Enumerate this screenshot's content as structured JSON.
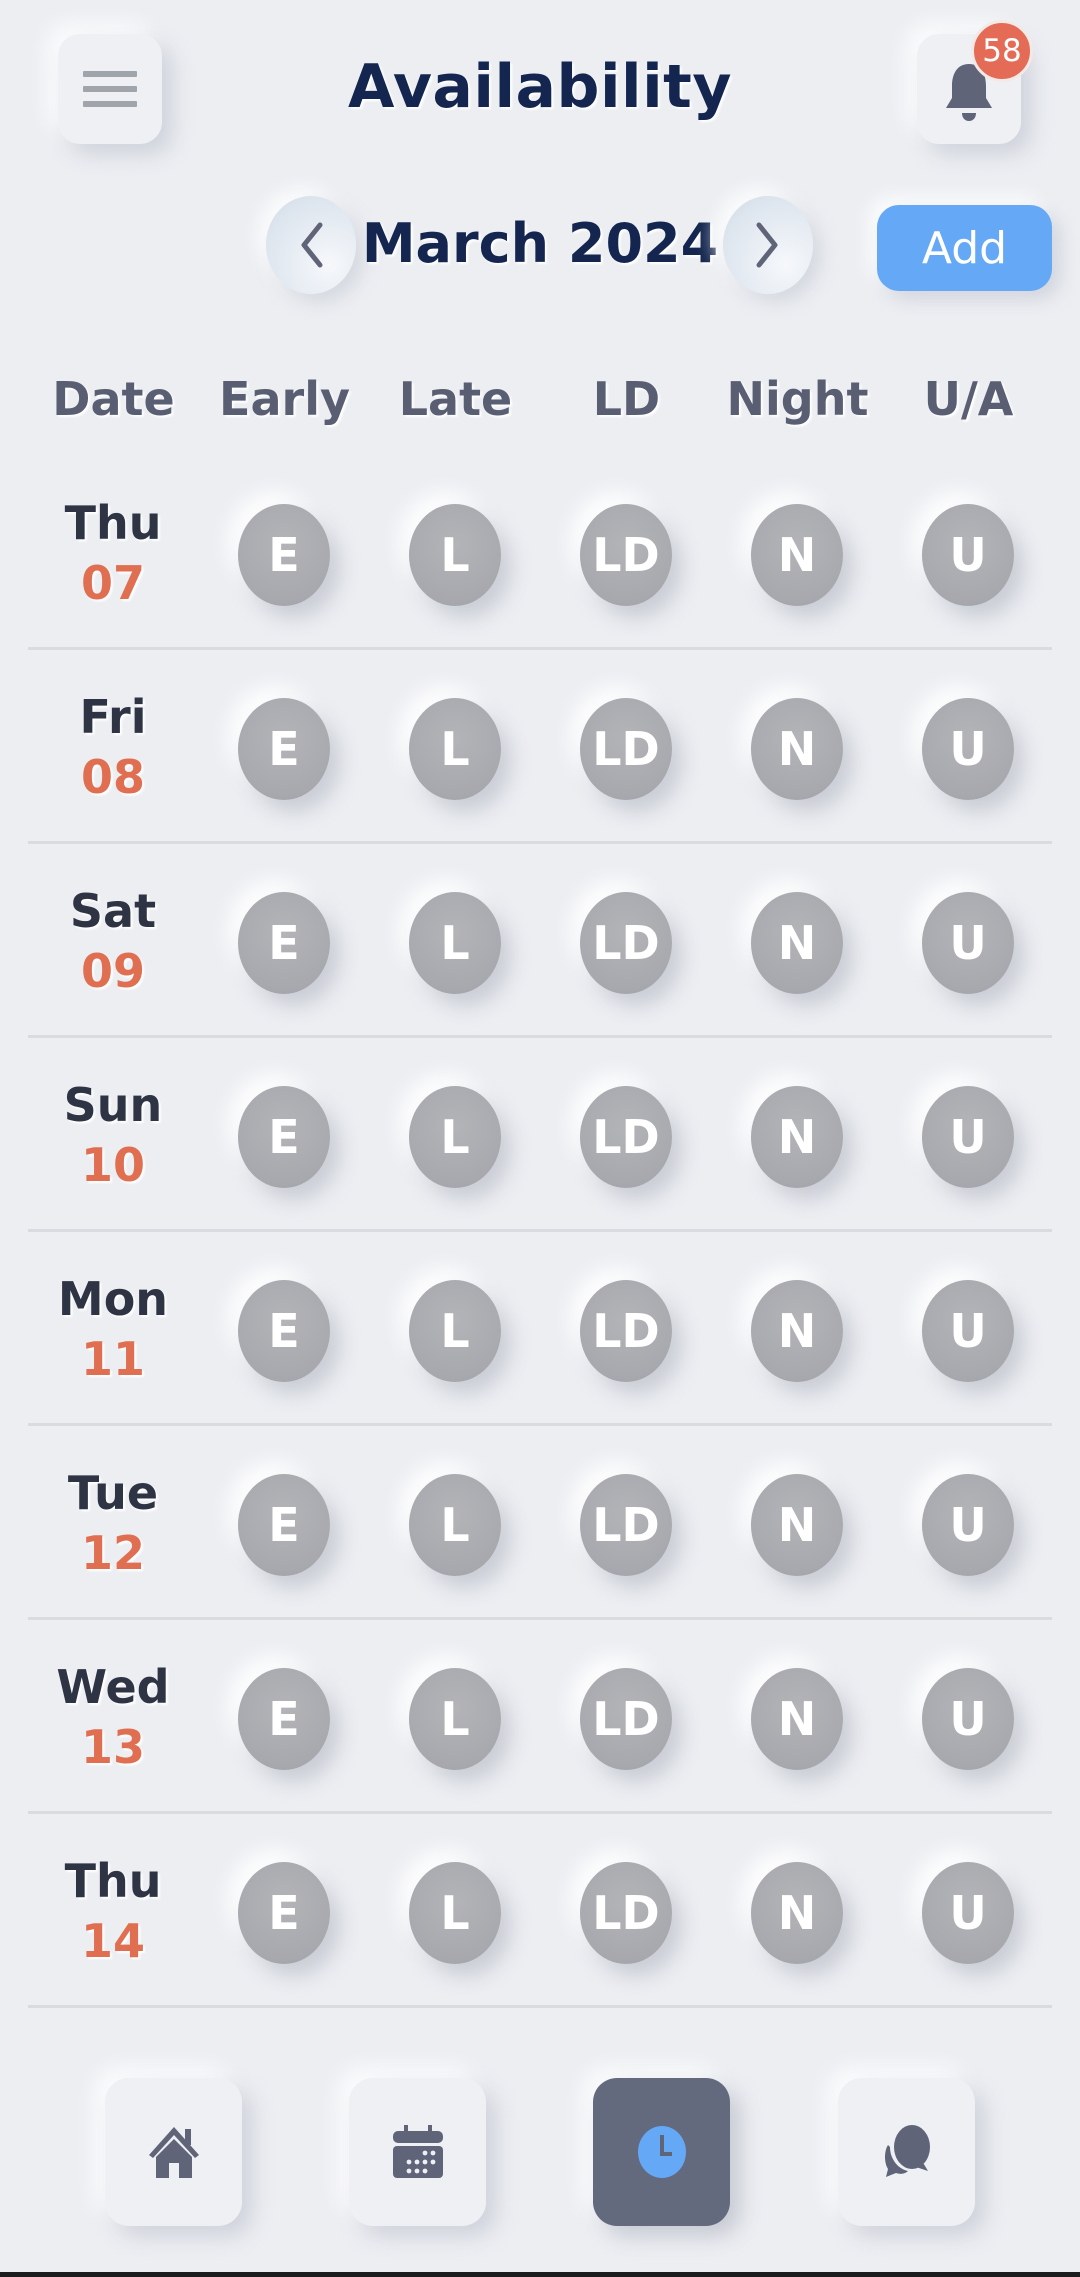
{
  "header": {
    "title": "Availability",
    "menu_icon": "hamburger-menu-icon",
    "notification_icon": "bell-icon",
    "notification_count": "58"
  },
  "month_nav": {
    "prev_icon": "chevron-left-icon",
    "month": "March 2024",
    "next_icon": "chevron-right-icon",
    "add_label": "Add"
  },
  "table": {
    "columns": [
      "Date",
      "Early",
      "Late",
      "LD",
      "Night",
      "U/A"
    ],
    "shift_codes": [
      "E",
      "L",
      "LD",
      "N",
      "U"
    ],
    "rows": [
      {
        "day": "Thu",
        "date": "07",
        "shifts": [
          "E",
          "L",
          "LD",
          "N",
          "U"
        ]
      },
      {
        "day": "Fri",
        "date": "08",
        "shifts": [
          "E",
          "L",
          "LD",
          "N",
          "U"
        ]
      },
      {
        "day": "Sat",
        "date": "09",
        "shifts": [
          "E",
          "L",
          "LD",
          "N",
          "U"
        ]
      },
      {
        "day": "Sun",
        "date": "10",
        "shifts": [
          "E",
          "L",
          "LD",
          "N",
          "U"
        ]
      },
      {
        "day": "Mon",
        "date": "11",
        "shifts": [
          "E",
          "L",
          "LD",
          "N",
          "U"
        ]
      },
      {
        "day": "Tue",
        "date": "12",
        "shifts": [
          "E",
          "L",
          "LD",
          "N",
          "U"
        ]
      },
      {
        "day": "Wed",
        "date": "13",
        "shifts": [
          "E",
          "L",
          "LD",
          "N",
          "U"
        ]
      },
      {
        "day": "Thu",
        "date": "14",
        "shifts": [
          "E",
          "L",
          "LD",
          "N",
          "U"
        ]
      }
    ]
  },
  "bottom_nav": {
    "items": [
      {
        "name": "home",
        "icon": "home-icon",
        "active": false
      },
      {
        "name": "calendar",
        "icon": "calendar-icon",
        "active": false
      },
      {
        "name": "availability",
        "icon": "clock-icon",
        "active": true
      },
      {
        "name": "messages",
        "icon": "chat-bubbles-icon",
        "active": false
      }
    ]
  },
  "colors": {
    "background": "#eceef2",
    "title": "#14264f",
    "accent_blue": "#64a8f6",
    "badge": "#e46b55",
    "date_number": "#e06f52",
    "shift_button": "#a9aaaf",
    "active_tab": "#636a7e",
    "icon": "#5f6479"
  }
}
